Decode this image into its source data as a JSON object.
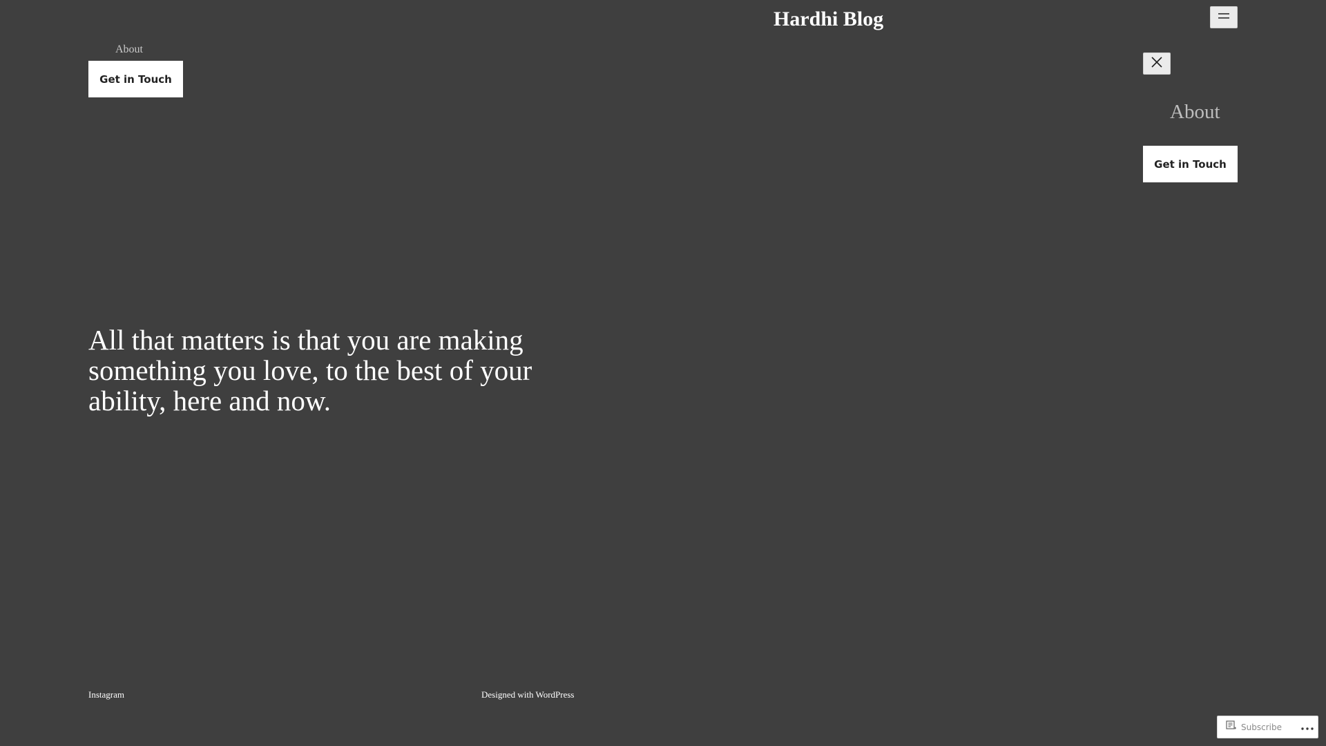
{
  "header": {
    "site_title": "Hardhi Blog"
  },
  "nav": {
    "about_label": "About",
    "cta_label": "Get in Touch"
  },
  "menu_panel": {
    "about_label": "About",
    "cta_label": "Get in Touch"
  },
  "main": {
    "quote": "All that matters is that you are making something you love, to the best of your ability, here and now."
  },
  "footer": {
    "instagram_label": "Instagram",
    "credit_prefix": "Designed with ",
    "credit_link": "WordPress"
  },
  "subscribe_bar": {
    "subscribe_label": "Subscribe"
  },
  "icons": {
    "menu": "hamburger-icon",
    "close": "close-icon",
    "subscribe": "reader-icon",
    "more": "more-icon"
  },
  "colors": {
    "background": "#3f3f3f",
    "text": "#ffffff",
    "muted_link": "#c9c9c9",
    "button_bg": "#ffffff",
    "button_text": "#222222"
  }
}
